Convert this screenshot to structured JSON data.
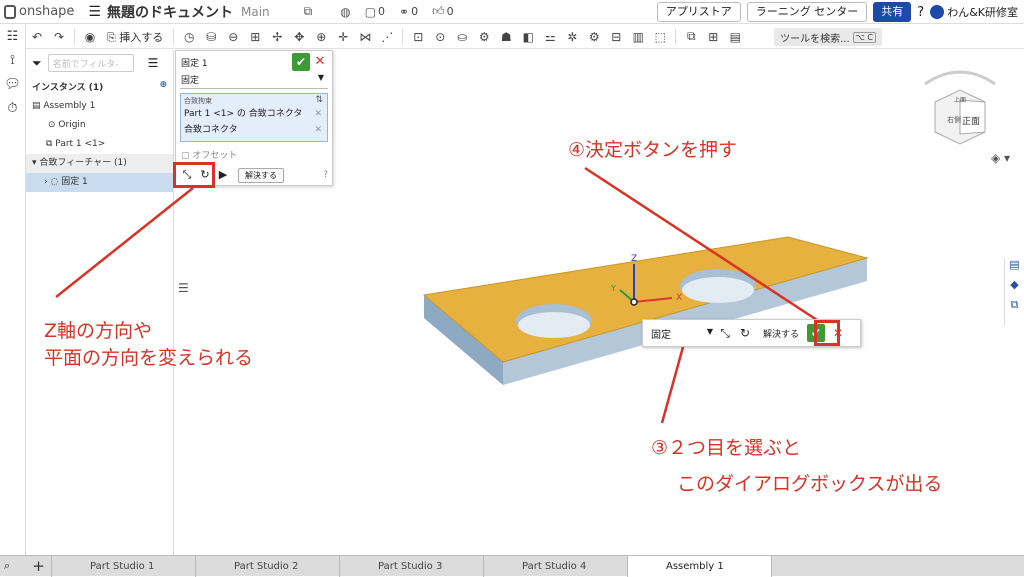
{
  "app": {
    "logo": "onshape",
    "doc_title": "無題のドキュメント",
    "branch": "Main",
    "counts": [
      "0",
      "0",
      "0"
    ]
  },
  "top_right": {
    "app_store": "アプリストア",
    "learning": "ラーニング センター",
    "share": "共有",
    "help": "?",
    "user": "わん&K研修室"
  },
  "toolbar": {
    "insert": "挿入する",
    "search": "ツールを検索...",
    "shortcut": "⌥ C"
  },
  "features": {
    "filter_placeholder": "名前でフィルタ-",
    "instances_head": "インスタンス (1)",
    "assembly": "Assembly 1",
    "origin": "Origin",
    "part": "Part 1 <1>",
    "mates_head": "合致フィーチャー (1)",
    "mate": "固定 1"
  },
  "dialog": {
    "title": "固定 1",
    "type": "固定",
    "sel_label": "合致拘束",
    "sel_items": [
      "Part 1 <1> の 合致コネクタ",
      "合致コネクタ"
    ],
    "offset": "オフセット",
    "resolve": "解決する"
  },
  "float_dialog": {
    "type": "固定",
    "resolve": "解決する"
  },
  "navcube": {
    "front": "正面",
    "right": "右側",
    "top": "上面"
  },
  "triad": {
    "x": "X",
    "y": "Y",
    "z": "Z"
  },
  "annotations": {
    "a1_line1": "Z軸の方向や",
    "a1_line2": "平面の方向を変えられる",
    "a2": "④決定ボタンを押す",
    "a3_line1": "③２つ目を選ぶと",
    "a3_line2": "このダイアログボックスが出る"
  },
  "tabs": [
    "Part Studio 1",
    "Part Studio 2",
    "Part Studio 3",
    "Part Studio 4",
    "Assembly 1"
  ],
  "colors": {
    "part_top": "#e6b13f",
    "part_side": "#9fb7cd",
    "accent_red": "#d93325",
    "ok_green": "#3d9b35"
  }
}
